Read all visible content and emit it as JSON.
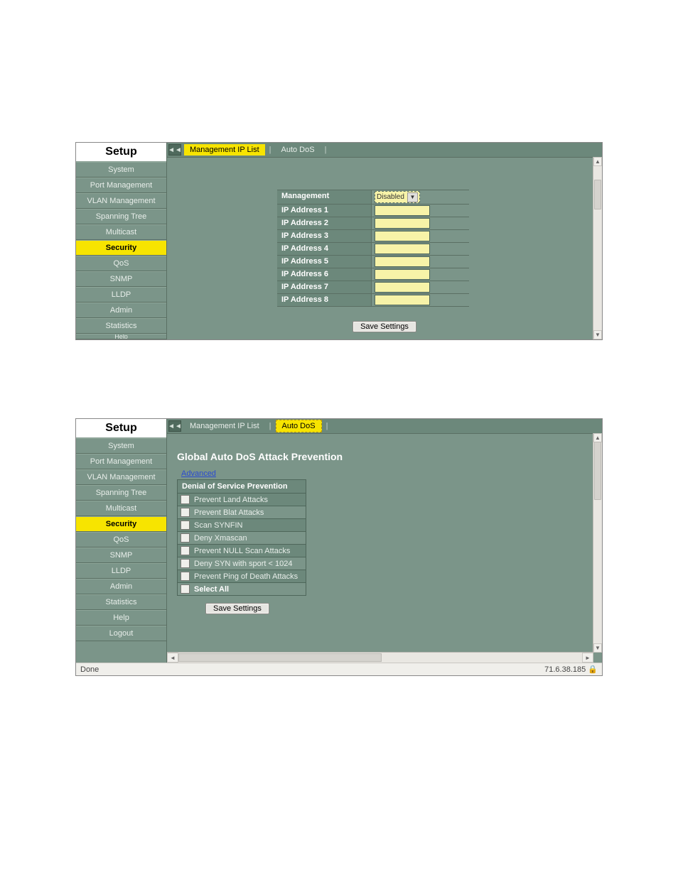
{
  "sidebar_title": "Setup",
  "nav_items": [
    "System",
    "Port Management",
    "VLAN Management",
    "Spanning Tree",
    "Multicast",
    "Security",
    "QoS",
    "SNMP",
    "LLDP",
    "Admin",
    "Statistics",
    "Help",
    "Logout"
  ],
  "nav_items_top_cut": "Help",
  "tabs": {
    "mgmt_ip_list": "Management IP List",
    "auto_dos": "Auto DoS"
  },
  "module1": {
    "rows": {
      "management_label": "Management",
      "ip_labels": [
        "IP Address 1",
        "IP Address 2",
        "IP Address 3",
        "IP Address 4",
        "IP Address 5",
        "IP Address 6",
        "IP Address 7",
        "IP Address 8"
      ]
    },
    "management_value": "Disabled",
    "save_label": "Save Settings"
  },
  "module2": {
    "title": "Global Auto DoS Attack Prevention",
    "advanced_link": "Advanced",
    "table_header": "Denial of Service Prevention",
    "rows": [
      "Prevent Land Attacks",
      "Prevent Blat Attacks",
      "Scan SYNFIN",
      "Deny Xmascan",
      "Prevent NULL Scan Attacks",
      "Deny SYN with sport < 1024",
      "Prevent Ping of Death Attacks",
      "Select All"
    ],
    "save_label": "Save Settings",
    "status_done": "Done",
    "status_ip": "71.6.38.185"
  }
}
